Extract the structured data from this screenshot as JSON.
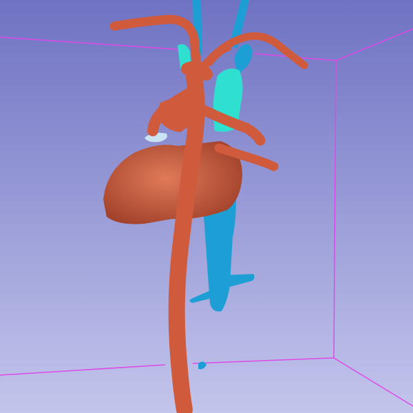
{
  "view": {
    "type": "3d-render-view",
    "background_top": "#6f72c2",
    "background_bottom": "#c3c5ec",
    "bounding_box_color": "#e048e8"
  },
  "anatomy": {
    "arterial_color": "#cf5a3c",
    "venous_color": "#1d9fd6",
    "pulmonary_vein_color": "#2fe0d0",
    "accessory_color": "#c9e3f2"
  }
}
